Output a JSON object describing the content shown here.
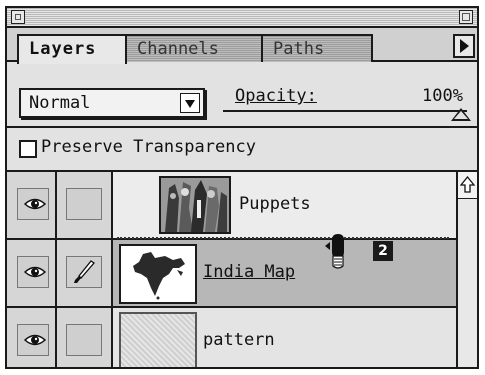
{
  "panel": {
    "tabs": [
      {
        "label": "Layers",
        "active": true
      },
      {
        "label": "Channels",
        "active": false
      },
      {
        "label": "Paths",
        "active": false
      }
    ],
    "tabs_menu_icon": "triangle-right-icon"
  },
  "controls": {
    "blend_mode": "Normal",
    "opacity_label": "Opacity:",
    "opacity_value": "100%",
    "opacity_level": 1.0
  },
  "preserve_transparency": {
    "label": "Preserve Transparency",
    "checked": false
  },
  "layers": [
    {
      "name": "Puppets",
      "visible": true,
      "brush": false,
      "selected": false,
      "thumbnail": "puppets-photo"
    },
    {
      "name": "India Map",
      "visible": true,
      "brush": true,
      "selected": true,
      "thumbnail": "india-map"
    },
    {
      "name": "pattern",
      "visible": true,
      "brush": false,
      "selected": false,
      "thumbnail": "pattern-texture"
    }
  ],
  "drag": {
    "badge": "2",
    "cursor_icon": "grab-hand-icon"
  },
  "colors": {
    "selected_row": "#b7b7b7",
    "panel_bg": "#d9d9d9",
    "border": "#1a1a1a"
  }
}
